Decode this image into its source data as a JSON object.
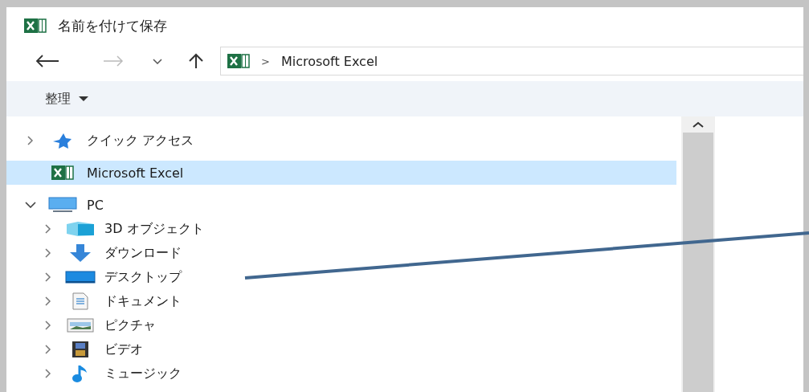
{
  "window": {
    "title": "名前を付けて保存"
  },
  "address_bar": {
    "separator": ">",
    "path": "Microsoft Excel"
  },
  "toolbar": {
    "organize": "整理"
  },
  "tree": [
    {
      "label": "クイック アクセス",
      "kind": "star",
      "expanded": false,
      "selected": false
    },
    {
      "label": "Microsoft Excel",
      "kind": "excel",
      "selected": true
    },
    {
      "label": "PC",
      "kind": "pc",
      "expanded": true,
      "selected": false,
      "children": [
        {
          "label": "3D オブジェクト",
          "kind": "cube",
          "expanded": false,
          "selected": false
        },
        {
          "label": "ダウンロード",
          "kind": "download",
          "expanded": false,
          "selected": false
        },
        {
          "label": "デスクトップ",
          "kind": "desktop",
          "expanded": false,
          "selected": false
        },
        {
          "label": "ドキュメント",
          "kind": "document",
          "expanded": false,
          "selected": false
        },
        {
          "label": "ピクチャ",
          "kind": "pictures",
          "expanded": false,
          "selected": false
        },
        {
          "label": "ビデオ",
          "kind": "video",
          "expanded": false,
          "selected": false
        },
        {
          "label": "ミュージック",
          "kind": "music",
          "expanded": false,
          "selected": false
        }
      ]
    }
  ]
}
